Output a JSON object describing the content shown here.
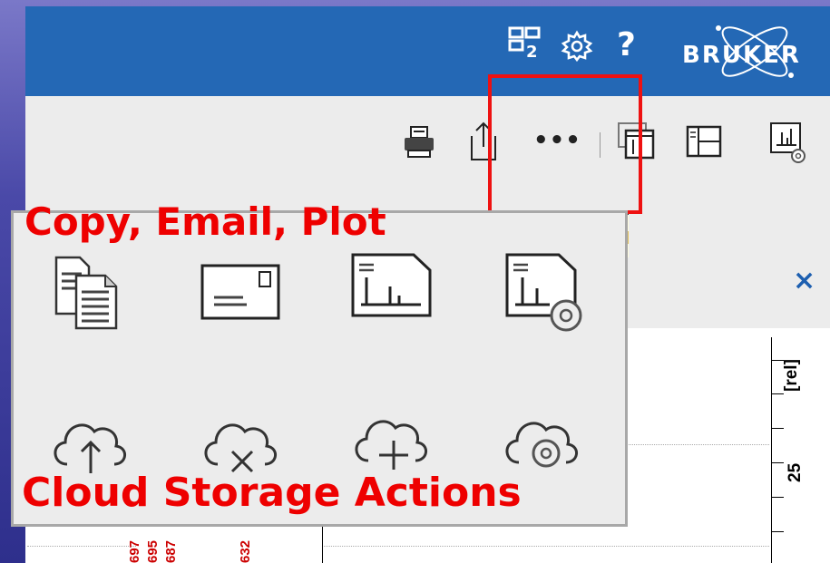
{
  "header": {
    "brand": "BRUKER",
    "layout_icon_badge": "2",
    "help_label": "?",
    "background_color": "#2468b5"
  },
  "toolbar": {
    "more_label": "•••"
  },
  "annotations": {
    "top_callout": "Copy, Email, Plot",
    "bottom_callout": "Cloud Storage Actions",
    "color": "#ee0000"
  },
  "popup_menu": {
    "row1": [
      "copy-icon",
      "email-icon",
      "plot-icon",
      "plot-settings-icon"
    ],
    "row2": [
      "cloud-upload-icon",
      "cloud-delete-icon",
      "cloud-add-icon",
      "cloud-settings-icon"
    ]
  },
  "panel": {
    "close_label": "×"
  },
  "plot": {
    "axis_unit": "[rel]",
    "axis_tick": "25",
    "peak_labels": [
      "697",
      "695",
      "687",
      "632"
    ]
  }
}
